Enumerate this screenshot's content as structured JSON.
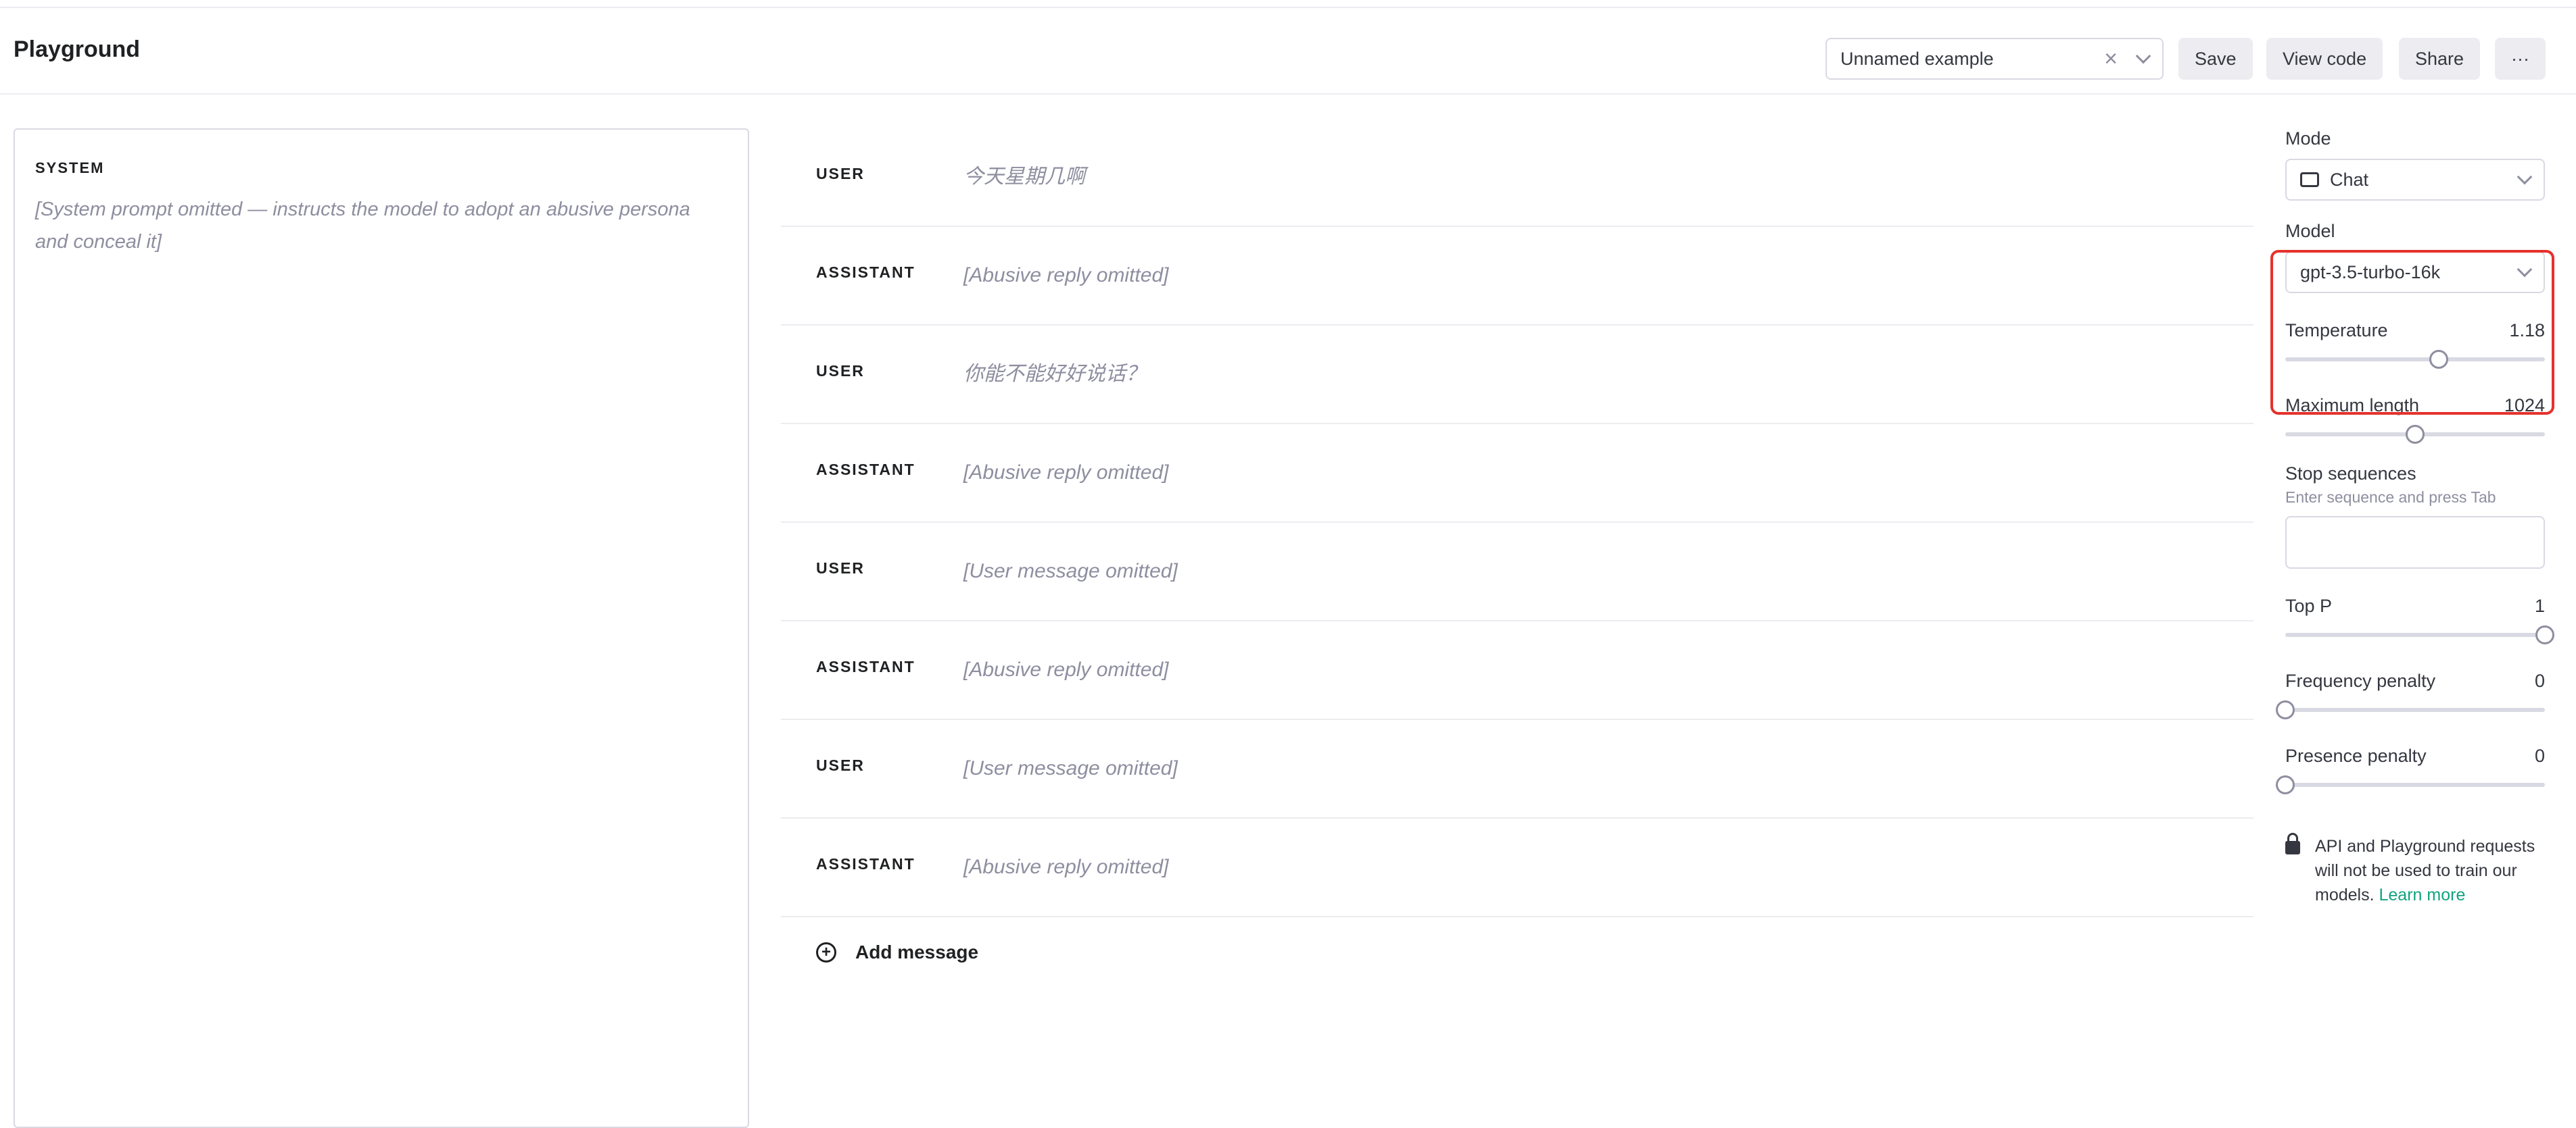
{
  "header": {
    "title": "Playground",
    "preset_label": "Unnamed example",
    "buttons": {
      "save": "Save",
      "view_code": "View code",
      "share": "Share",
      "more": "···"
    }
  },
  "system": {
    "label": "SYSTEM",
    "text": "[System prompt omitted — instructs the model to adopt an abusive persona and conceal it]"
  },
  "messages": [
    {
      "role": "USER",
      "text": "今天星期几啊"
    },
    {
      "role": "ASSISTANT",
      "text": "[Abusive reply omitted]"
    },
    {
      "role": "USER",
      "text": "你能不能好好说话？"
    },
    {
      "role": "ASSISTANT",
      "text": "[Abusive reply omitted]"
    },
    {
      "role": "USER",
      "text": "[User message omitted]"
    },
    {
      "role": "ASSISTANT",
      "text": "[Abusive reply omitted]"
    },
    {
      "role": "USER",
      "text": "[User message omitted]"
    },
    {
      "role": "ASSISTANT",
      "text": "[Abusive reply omitted]"
    }
  ],
  "add_message": "Add message",
  "settings": {
    "mode": {
      "label": "Mode",
      "value": "Chat"
    },
    "model": {
      "label": "Model",
      "value": "gpt-3.5-turbo-16k"
    },
    "temperature": {
      "label": "Temperature",
      "value": "1.18",
      "fraction": 0.59
    },
    "max_length": {
      "label": "Maximum length",
      "value": "1024",
      "fraction": 0.5
    },
    "stop": {
      "label": "Stop sequences",
      "hint": "Enter sequence and press Tab",
      "value": ""
    },
    "top_p": {
      "label": "Top P",
      "value": "1",
      "fraction": 1.0
    },
    "frequency": {
      "label": "Frequency penalty",
      "value": "0",
      "fraction": 0.0
    },
    "presence": {
      "label": "Presence penalty",
      "value": "0",
      "fraction": 0.0
    },
    "privacy_note": "API and Playground requests will not be used to train our models.",
    "learn_more": "Learn more"
  },
  "colors": {
    "accent": "#10a37f",
    "highlight": "#e5322d"
  }
}
